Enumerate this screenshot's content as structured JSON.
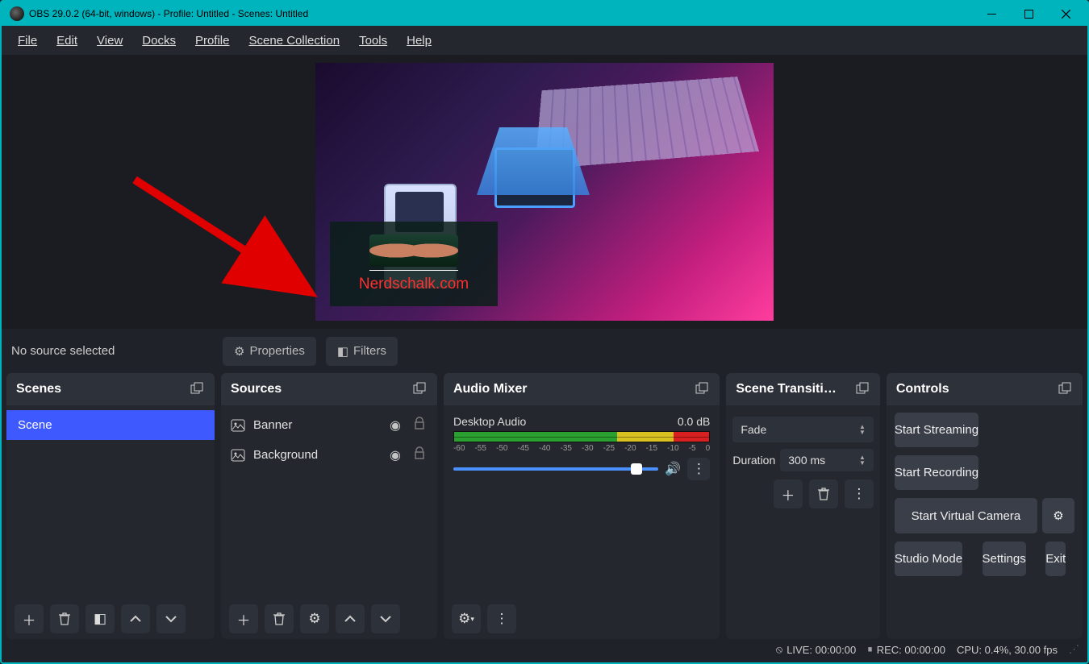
{
  "window": {
    "title": "OBS 29.0.2 (64-bit, windows) - Profile: Untitled - Scenes: Untitled"
  },
  "menu": [
    "File",
    "Edit",
    "View",
    "Docks",
    "Profile",
    "Scene Collection",
    "Tools",
    "Help"
  ],
  "overlay": {
    "brand": "Nerdschalk.com"
  },
  "src_toolbar": {
    "label": "No source selected",
    "properties": "Properties",
    "filters": "Filters"
  },
  "panels": {
    "scenes": {
      "title": "Scenes",
      "items": [
        "Scene"
      ]
    },
    "sources": {
      "title": "Sources",
      "items": [
        {
          "name": "Banner"
        },
        {
          "name": "Background"
        }
      ]
    },
    "mixer": {
      "title": "Audio Mixer",
      "channel": {
        "name": "Desktop Audio",
        "db": "0.0 dB"
      },
      "ticks": [
        "-60",
        "-55",
        "-50",
        "-45",
        "-40",
        "-35",
        "-30",
        "-25",
        "-20",
        "-15",
        "-10",
        "-5",
        "0"
      ]
    },
    "transitions": {
      "title": "Scene Transiti…",
      "selected": "Fade",
      "duration_label": "Duration",
      "duration": "300 ms"
    },
    "controls": {
      "title": "Controls",
      "buttons": [
        "Start Streaming",
        "Start Recording",
        "Start Virtual Camera",
        "Studio Mode",
        "Settings",
        "Exit"
      ]
    }
  },
  "status": {
    "live": "LIVE: 00:00:00",
    "rec": "REC: 00:00:00",
    "cpu": "CPU: 0.4%, 30.00 fps"
  }
}
